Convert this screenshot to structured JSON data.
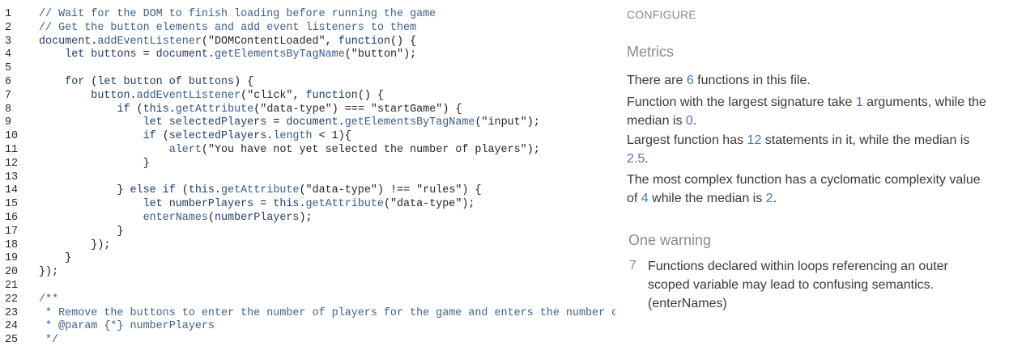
{
  "code_lines": [
    {
      "n": "1",
      "t": [
        [
          "c",
          "// Wait for the DOM to finish loading before running the game"
        ]
      ]
    },
    {
      "n": "2",
      "t": [
        [
          "c",
          "// Get the button elements and add event listeners to them"
        ]
      ]
    },
    {
      "n": "3",
      "t": [
        [
          "v",
          "document"
        ],
        [
          "",
          "."
        ],
        [
          "m",
          "addEventListener"
        ],
        [
          "",
          "("
        ],
        [
          "s",
          "\"DOMContentLoaded\""
        ],
        [
          "",
          ", "
        ],
        [
          "k",
          "function"
        ],
        [
          "",
          "() {"
        ]
      ]
    },
    {
      "n": "4",
      "t": [
        [
          "",
          "    "
        ],
        [
          "k",
          "let"
        ],
        [
          "v",
          " buttons"
        ],
        [
          "",
          " = "
        ],
        [
          "v",
          "document"
        ],
        [
          "",
          "."
        ],
        [
          "m",
          "getElementsByTagName"
        ],
        [
          "",
          "("
        ],
        [
          "s",
          "\"button\""
        ],
        [
          "",
          ");"
        ]
      ]
    },
    {
      "n": "5",
      "t": []
    },
    {
      "n": "6",
      "t": [
        [
          "",
          "    "
        ],
        [
          "k",
          "for"
        ],
        [
          "",
          " ("
        ],
        [
          "k",
          "let"
        ],
        [
          "v",
          " button"
        ],
        [
          "k",
          " of"
        ],
        [
          "v",
          " buttons"
        ],
        [
          "",
          ") {"
        ]
      ]
    },
    {
      "n": "7",
      "t": [
        [
          "",
          "        "
        ],
        [
          "v",
          "button"
        ],
        [
          "",
          "."
        ],
        [
          "m",
          "addEventListener"
        ],
        [
          "",
          "("
        ],
        [
          "s",
          "\"click\""
        ],
        [
          "",
          ", "
        ],
        [
          "k",
          "function"
        ],
        [
          "",
          "() {"
        ]
      ]
    },
    {
      "n": "8",
      "t": [
        [
          "",
          "            "
        ],
        [
          "k",
          "if"
        ],
        [
          "",
          " ("
        ],
        [
          "k",
          "this"
        ],
        [
          "",
          "."
        ],
        [
          "m",
          "getAttribute"
        ],
        [
          "",
          "("
        ],
        [
          "s",
          "\"data-type\""
        ],
        [
          "",
          ") === "
        ],
        [
          "s",
          "\"startGame\""
        ],
        [
          "",
          ") {"
        ]
      ]
    },
    {
      "n": "9",
      "t": [
        [
          "",
          "                "
        ],
        [
          "k",
          "let"
        ],
        [
          "v",
          " selectedPlayers"
        ],
        [
          "",
          " = "
        ],
        [
          "v",
          "document"
        ],
        [
          "",
          "."
        ],
        [
          "m",
          "getElementsByTagName"
        ],
        [
          "",
          "("
        ],
        [
          "s",
          "\"input\""
        ],
        [
          "",
          ");"
        ]
      ]
    },
    {
      "n": "10",
      "t": [
        [
          "",
          "                "
        ],
        [
          "k",
          "if"
        ],
        [
          "",
          " ("
        ],
        [
          "v",
          "selectedPlayers"
        ],
        [
          "",
          "."
        ],
        [
          "m",
          "length"
        ],
        [
          "",
          " < 1){"
        ]
      ]
    },
    {
      "n": "11",
      "t": [
        [
          "",
          "                    "
        ],
        [
          "m",
          "alert"
        ],
        [
          "",
          "("
        ],
        [
          "s",
          "\"You have not yet selected the number of players\""
        ],
        [
          "",
          ");"
        ]
      ]
    },
    {
      "n": "12",
      "t": [
        [
          "",
          "                }"
        ]
      ]
    },
    {
      "n": "13",
      "t": []
    },
    {
      "n": "14",
      "t": [
        [
          "",
          "            } "
        ],
        [
          "k",
          "else if"
        ],
        [
          "",
          " ("
        ],
        [
          "k",
          "this"
        ],
        [
          "",
          "."
        ],
        [
          "m",
          "getAttribute"
        ],
        [
          "",
          "("
        ],
        [
          "s",
          "\"data-type\""
        ],
        [
          "",
          ") !== "
        ],
        [
          "s",
          "\"rules\""
        ],
        [
          "",
          ") {"
        ]
      ]
    },
    {
      "n": "15",
      "t": [
        [
          "",
          "                "
        ],
        [
          "k",
          "let"
        ],
        [
          "v",
          " numberPlayers"
        ],
        [
          "",
          " = "
        ],
        [
          "k",
          "this"
        ],
        [
          "",
          "."
        ],
        [
          "m",
          "getAttribute"
        ],
        [
          "",
          "("
        ],
        [
          "s",
          "\"data-type\""
        ],
        [
          "",
          ");"
        ]
      ]
    },
    {
      "n": "16",
      "t": [
        [
          "",
          "                "
        ],
        [
          "m",
          "enterNames"
        ],
        [
          "",
          "("
        ],
        [
          "v",
          "numberPlayers"
        ],
        [
          "",
          ");"
        ]
      ]
    },
    {
      "n": "17",
      "t": [
        [
          "",
          "            }"
        ]
      ]
    },
    {
      "n": "18",
      "t": [
        [
          "",
          "        });"
        ]
      ]
    },
    {
      "n": "19",
      "t": [
        [
          "",
          "    }"
        ]
      ]
    },
    {
      "n": "20",
      "t": [
        [
          "",
          "});"
        ]
      ]
    },
    {
      "n": "21",
      "t": []
    },
    {
      "n": "22",
      "t": [
        [
          "c",
          "/**"
        ]
      ]
    },
    {
      "n": "23",
      "t": [
        [
          "c",
          " * Remove the buttons to enter the number of players for the game and enters the number of"
        ]
      ]
    },
    {
      "n": "24",
      "t": [
        [
          "c",
          " * @param {*} numberPlayers"
        ]
      ]
    },
    {
      "n": "25",
      "t": [
        [
          "c",
          " */"
        ]
      ]
    }
  ],
  "panel": {
    "configure": "CONFIGURE",
    "metrics_title": "Metrics",
    "m1": {
      "a": "There are ",
      "n1": "6",
      "b": " functions in this file."
    },
    "m2": {
      "a": "Function with the largest signature take ",
      "n1": "1",
      "b": " arguments, while the median is ",
      "n2": "0",
      "c": "."
    },
    "m3": {
      "a": "Largest function has ",
      "n1": "12",
      "b": " statements in it, while the median is ",
      "n2": "2.5",
      "c": "."
    },
    "m4": {
      "a": "The most complex function has a cyclomatic complexity value of ",
      "n1": "4",
      "b": " while the median is ",
      "n2": "2",
      "c": "."
    },
    "warning_title": "One warning",
    "warning_line": "7",
    "warning_message": "Functions declared within loops referencing an outer scoped variable may lead to confusing semantics. (enterNames)"
  },
  "colors": {
    "accent_number": "#4b77b0",
    "comment": "#43608c",
    "keyword": "#1c3a70"
  }
}
